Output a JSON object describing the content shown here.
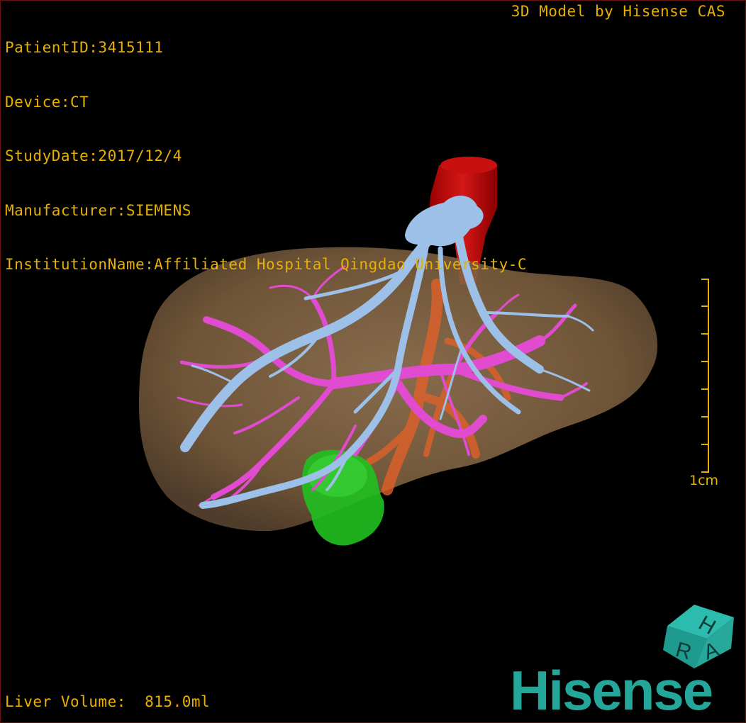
{
  "overlay": {
    "patient_id": "PatientID:3415111",
    "device": "Device:CT",
    "study_date": "StudyDate:2017/12/4",
    "manufacturer": "Manufacturer:SIEMENS",
    "institution": "InstitutionName:Affiliated Hospital Qingdao University-C",
    "credit": "3D Model by Hisense CAS",
    "volume": "Liver Volume:  815.0ml"
  },
  "scale": {
    "label": "1cm",
    "ticks": 8
  },
  "orientation_cube": {
    "letters": [
      "H",
      "R",
      "A"
    ],
    "color": "#27a89b"
  },
  "brand": {
    "name": "Hisense",
    "color": "#24a79a"
  },
  "colors": {
    "liver": "#8a6a48",
    "hepatic_vein": "#9cc0e8",
    "portal_vein": "#e04bd0",
    "ivc": "#d41010",
    "gallbladder": "#1fc41f",
    "artery": "#e0602a",
    "accent_text": "#e8b000"
  }
}
